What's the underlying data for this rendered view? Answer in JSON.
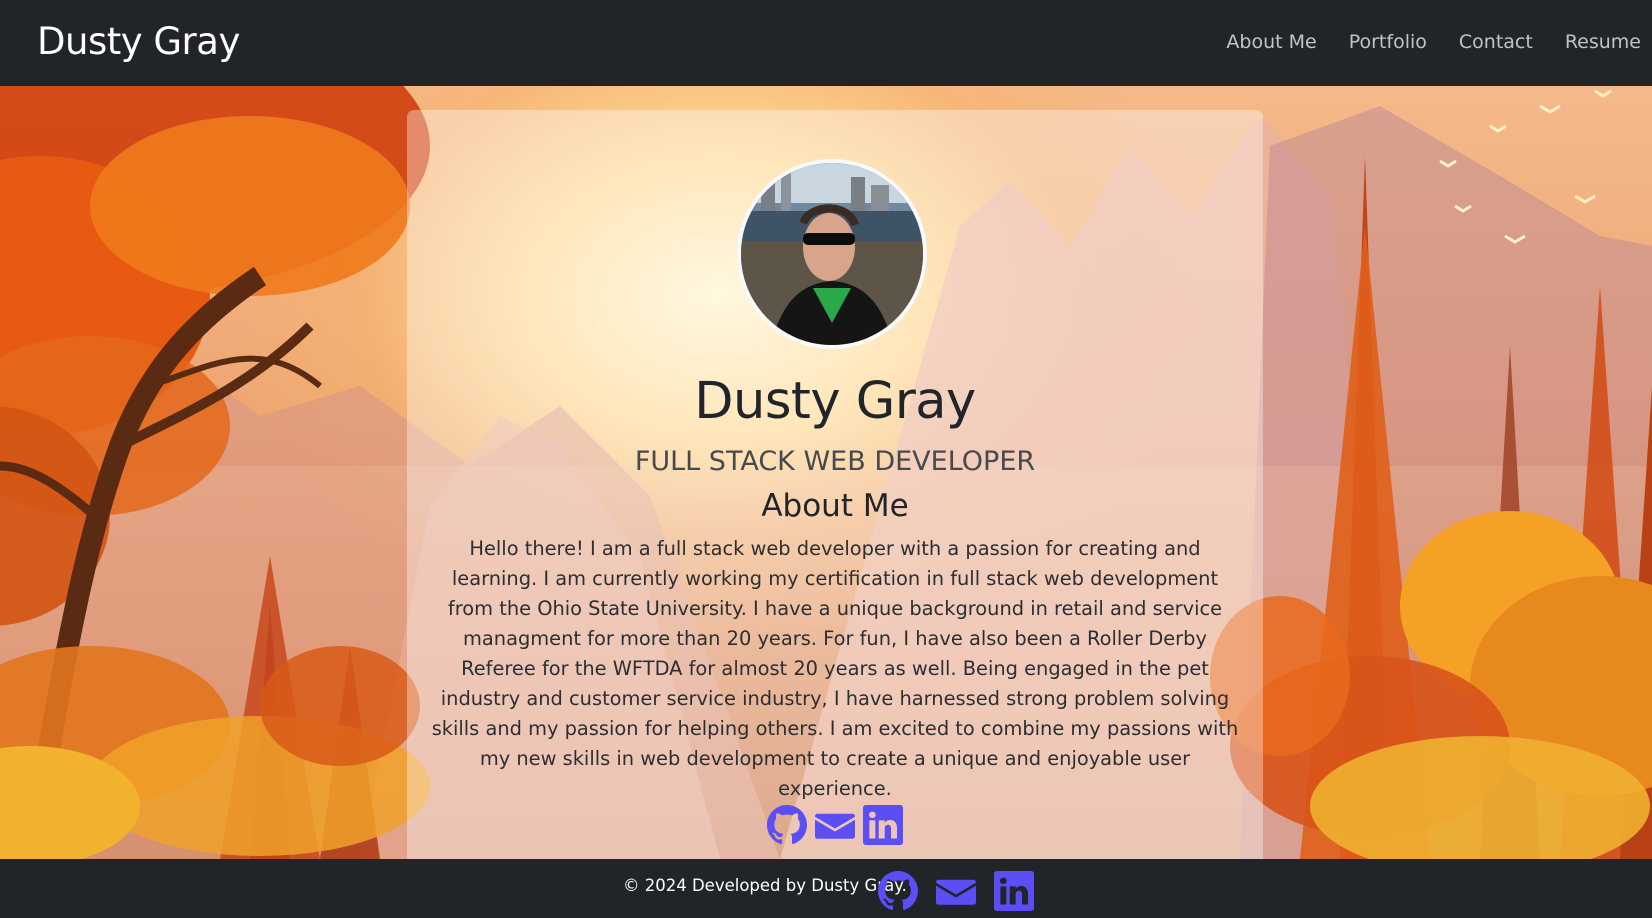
{
  "navbar": {
    "brand": "Dusty Gray",
    "links": [
      "About Me",
      "Portfolio",
      "Contact",
      "Resume"
    ]
  },
  "profile": {
    "name": "Dusty Gray",
    "title": "FULL STACK WEB DEVELOPER",
    "section_heading": "About Me",
    "bio": "Hello there! I am a full stack web developer with a passion for creating and learning. I am currently working my certification in full stack web development from the Ohio State University. I have a unique background in retail and service managment for more than 20 years. For fun, I have also been a Roller Derby Referee for the WFTDA for almost 20 years as well. Being engaged in the pet industry and customer service industry, I have harnessed strong problem solving skills and my passion for helping others. I am excited to combine my passions with my new skills in web development to create a unique and enjoyable user experience.",
    "social_icons": [
      "github-icon",
      "envelope-icon",
      "linkedin-icon"
    ]
  },
  "footer": {
    "text": "© 2024 Developed by Dusty Gray.",
    "social_icons": [
      "github-icon",
      "envelope-icon",
      "linkedin-icon"
    ]
  },
  "colors": {
    "navbar_bg": "#212529",
    "icon_accent": "#5b4ef5",
    "card_overlay": "rgba(255,255,255,0.36)"
  }
}
